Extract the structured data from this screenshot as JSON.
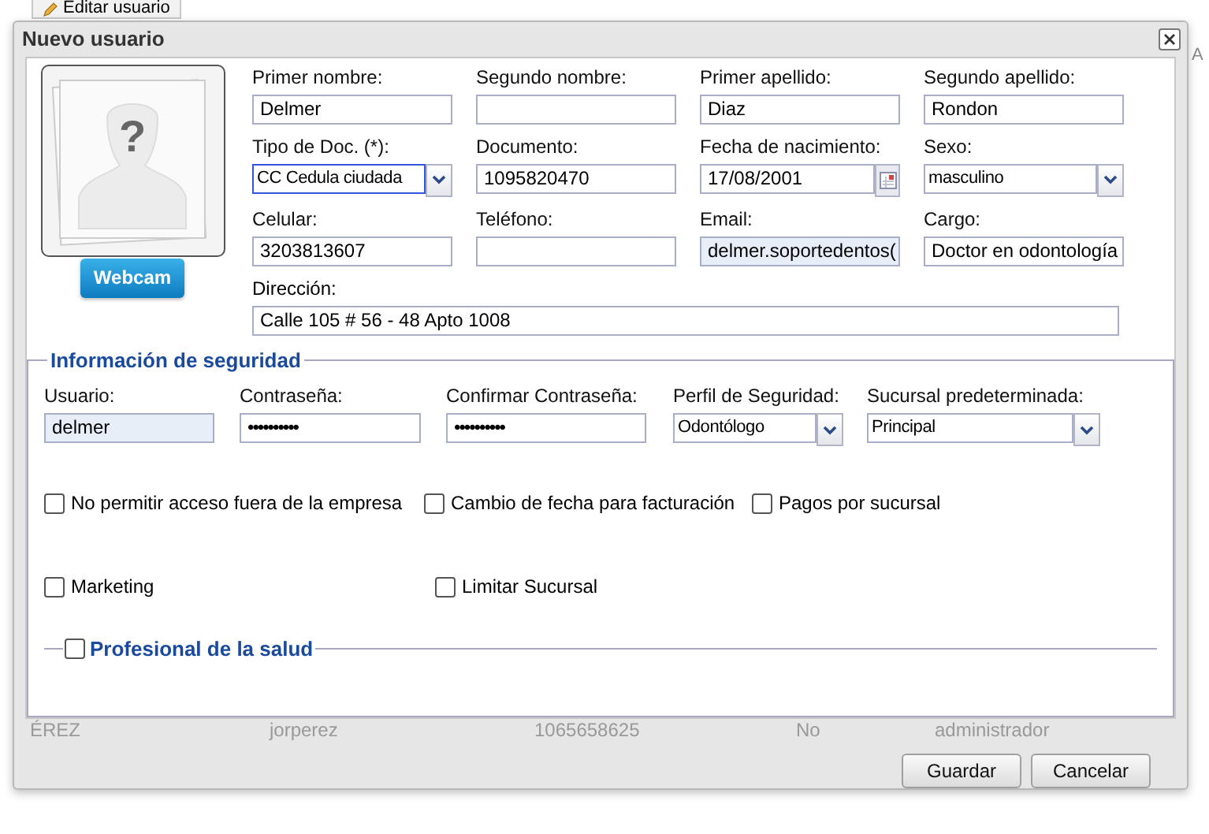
{
  "toolbar": {
    "button": "Editar usuario"
  },
  "background_grid": {
    "header_last": "A",
    "row": [
      "ÉREZ",
      "jorperez",
      "1065658625",
      "No",
      "administrador"
    ]
  },
  "dialog": {
    "title": "Nuevo usuario"
  },
  "photo": {
    "mark": "?",
    "button": "Webcam"
  },
  "personal_fields": [
    {
      "label": "Primer nombre:",
      "value": "Delmer",
      "kind": "text",
      "focused": false,
      "autofilled": false
    },
    {
      "label": "Segundo nombre:",
      "kind": "text",
      "focused": false,
      "autofilled": false
    },
    {
      "label": "Primer apellido:",
      "value": "Diaz",
      "kind": "text",
      "focused": false,
      "autofilled": false
    },
    {
      "label": "Segundo apellido:",
      "value": "Rondon",
      "kind": "text",
      "focused": false,
      "autofilled": false
    },
    {
      "label": "Tipo de Doc. (*):",
      "value": "CC Cedula ciudada",
      "kind": "select",
      "focused": true,
      "autofilled": false
    },
    {
      "label": "Documento:",
      "value": "1095820470",
      "kind": "text",
      "focused": false,
      "autofilled": false
    },
    {
      "label": "Fecha de nacimiento:",
      "value": "17/08/2001",
      "kind": "date",
      "focused": false,
      "autofilled": false
    },
    {
      "label": "Sexo:",
      "value": "masculino",
      "kind": "select",
      "focused": false,
      "autofilled": false
    },
    {
      "label": "Celular:",
      "value": "3203813607",
      "kind": "text",
      "focused": false,
      "autofilled": false
    },
    {
      "label": "Teléfono:",
      "kind": "text",
      "focused": false,
      "autofilled": false
    },
    {
      "label": "Email:",
      "value": "delmer.soportedentos(",
      "kind": "text",
      "focused": false,
      "autofilled": true
    },
    {
      "label": "Cargo:",
      "value": "Doctor en odontología",
      "kind": "text",
      "focused": false,
      "autofilled": false
    }
  ],
  "address": {
    "label": "Dirección:",
    "value": "Calle 105 # 56 - 48 Apto 1008"
  },
  "security": {
    "legend": "Información de seguridad",
    "fields": [
      {
        "label": "Usuario:",
        "value": "delmer",
        "kind": "text",
        "autofilled": true
      },
      {
        "label": "Contraseña:",
        "value": "••••••••••",
        "kind": "password",
        "autofilled": false
      },
      {
        "label": "Confirmar Contraseña:",
        "value": "••••••••••",
        "kind": "password",
        "autofilled": false
      },
      {
        "label": "Perfil de Seguridad:",
        "value": "Odontólogo",
        "kind": "select",
        "autofilled": false
      },
      {
        "label": "Sucursal predeterminada:",
        "value": "Principal",
        "kind": "select",
        "autofilled": false
      }
    ]
  },
  "options": [
    [
      {
        "label": "No permitir acceso fuera de la empresa",
        "checked": false
      },
      {
        "label": "Cambio de fecha para facturación",
        "checked": false
      },
      {
        "label": "Pagos por sucursal",
        "checked": false
      }
    ],
    [
      {
        "label": "Marketing",
        "checked": false
      },
      {
        "label": "Limitar Sucursal",
        "checked": false
      }
    ]
  ],
  "health_professional": {
    "label": "Profesional de la salud",
    "checked": false
  },
  "buttons": [
    "Guardar",
    "Cancelar"
  ]
}
